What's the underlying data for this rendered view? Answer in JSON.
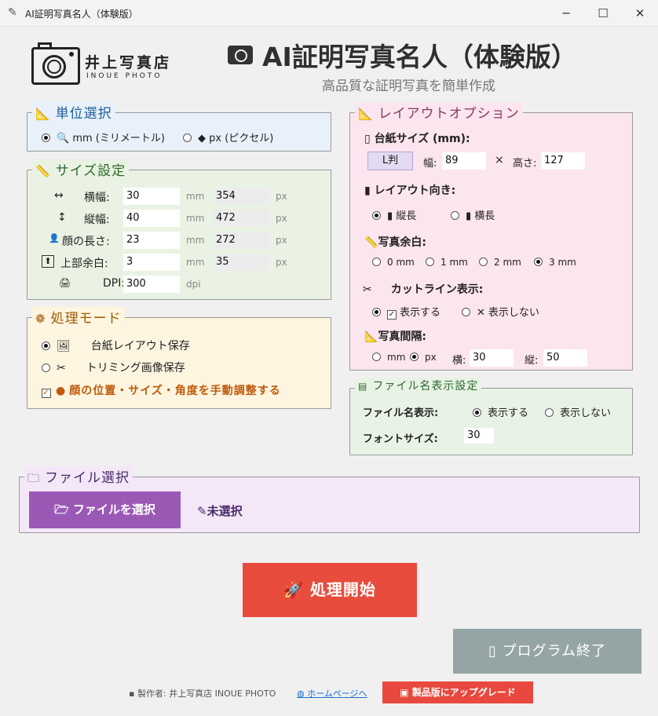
{
  "window": {
    "title": "AI証明写真名人（体験版）",
    "app_icon": "feather-icon",
    "minimize": "─",
    "maximize": "☐",
    "close": "✕"
  },
  "logo": {
    "name": "井上写真店",
    "sub": "INOUE PHOTO"
  },
  "header": {
    "title": "AI証明写真名人（体験版）",
    "subtitle": "高品質な証明写真を簡単作成"
  },
  "unit_select": {
    "legend": "単位選択",
    "options": [
      {
        "label": "mm (ミリメートル)",
        "selected": true
      },
      {
        "label": "px (ピクセル)",
        "selected": false
      }
    ]
  },
  "size_settings": {
    "legend": "サイズ設定",
    "rows": [
      {
        "icon": "↔",
        "label": "横幅:",
        "mm": "30",
        "mm_unit": "mm",
        "px": "354",
        "px_unit": "px"
      },
      {
        "icon": "↕",
        "label": "縦幅:",
        "mm": "40",
        "mm_unit": "mm",
        "px": "472",
        "px_unit": "px"
      },
      {
        "icon": "👤",
        "label": "顔の長さ:",
        "mm": "23",
        "mm_unit": "mm",
        "px": "272",
        "px_unit": "px"
      },
      {
        "icon": "⬆",
        "label": "上部余白:",
        "mm": "3",
        "mm_unit": "mm",
        "px": "35",
        "px_unit": "px"
      }
    ],
    "dpi": {
      "icon": "🖨",
      "label": "DPI:",
      "value": "300",
      "unit": "dpi"
    }
  },
  "processing_mode": {
    "legend": "処理モード",
    "options": [
      {
        "icon": "🖼",
        "label": "台紙レイアウト保存",
        "selected": true
      },
      {
        "icon": "✂",
        "label": "トリミング画像保存",
        "selected": false
      }
    ],
    "manual_adjust": {
      "label": "顔の位置・サイズ・角度を手動調整する",
      "checked": true
    }
  },
  "layout_options": {
    "legend": "レイアウトオプション",
    "paper_size": {
      "title": "台紙サイズ (mm):",
      "preset_button": "L判",
      "width_label": "幅:",
      "width": "89",
      "times": "×",
      "height_label": "高さ:",
      "height": "127"
    },
    "orientation": {
      "title": "レイアウト向き:",
      "options": [
        {
          "label": "縦長",
          "selected": true
        },
        {
          "label": "横長",
          "selected": false
        }
      ]
    },
    "margin": {
      "title": "写真余白:",
      "options": [
        {
          "label": "0 mm",
          "selected": false
        },
        {
          "label": "1 mm",
          "selected": false
        },
        {
          "label": "2 mm",
          "selected": false
        },
        {
          "label": "3 mm",
          "selected": true
        }
      ]
    },
    "cutline": {
      "title": "カットライン表示:",
      "options": [
        {
          "label": "表示する",
          "selected": true
        },
        {
          "label": "表示しない",
          "selected": false
        }
      ]
    },
    "spacing": {
      "title": "写真間隔:",
      "units": [
        {
          "label": "mm",
          "selected": false
        },
        {
          "label": "px",
          "selected": true
        }
      ],
      "h_label": "横:",
      "h_value": "30",
      "v_label": "縦:",
      "v_value": "50"
    }
  },
  "filename_display": {
    "legend": "ファイル名表示設定",
    "label": "ファイル名表示:",
    "options": [
      {
        "label": "表示する",
        "selected": true
      },
      {
        "label": "表示しない",
        "selected": false
      }
    ],
    "font_label": "フォントサイズ:",
    "font_value": "30"
  },
  "file_select": {
    "legend": "ファイル選択",
    "button": "ファイルを選択",
    "status": "未選択"
  },
  "actions": {
    "start": "処理開始",
    "exit": "プログラム終了"
  },
  "footer": {
    "maker": "製作者: 井上写真店 INOUE PHOTO",
    "homepage": "ホームページへ",
    "upgrade": "製品版にアップグレード"
  },
  "colors": {
    "unit_bg": "#e8f1fa",
    "size_bg": "#eaf3e3",
    "mode_bg": "#fdf5e0",
    "layout_bg": "#fbe5ee",
    "fname_bg": "#e8f2e5",
    "file_bg": "#f4e7f8",
    "purple_btn": "#9b59b6",
    "red_btn": "#e74c3c",
    "gray_btn": "#95a5a6",
    "accent_red": "#e8483d"
  }
}
